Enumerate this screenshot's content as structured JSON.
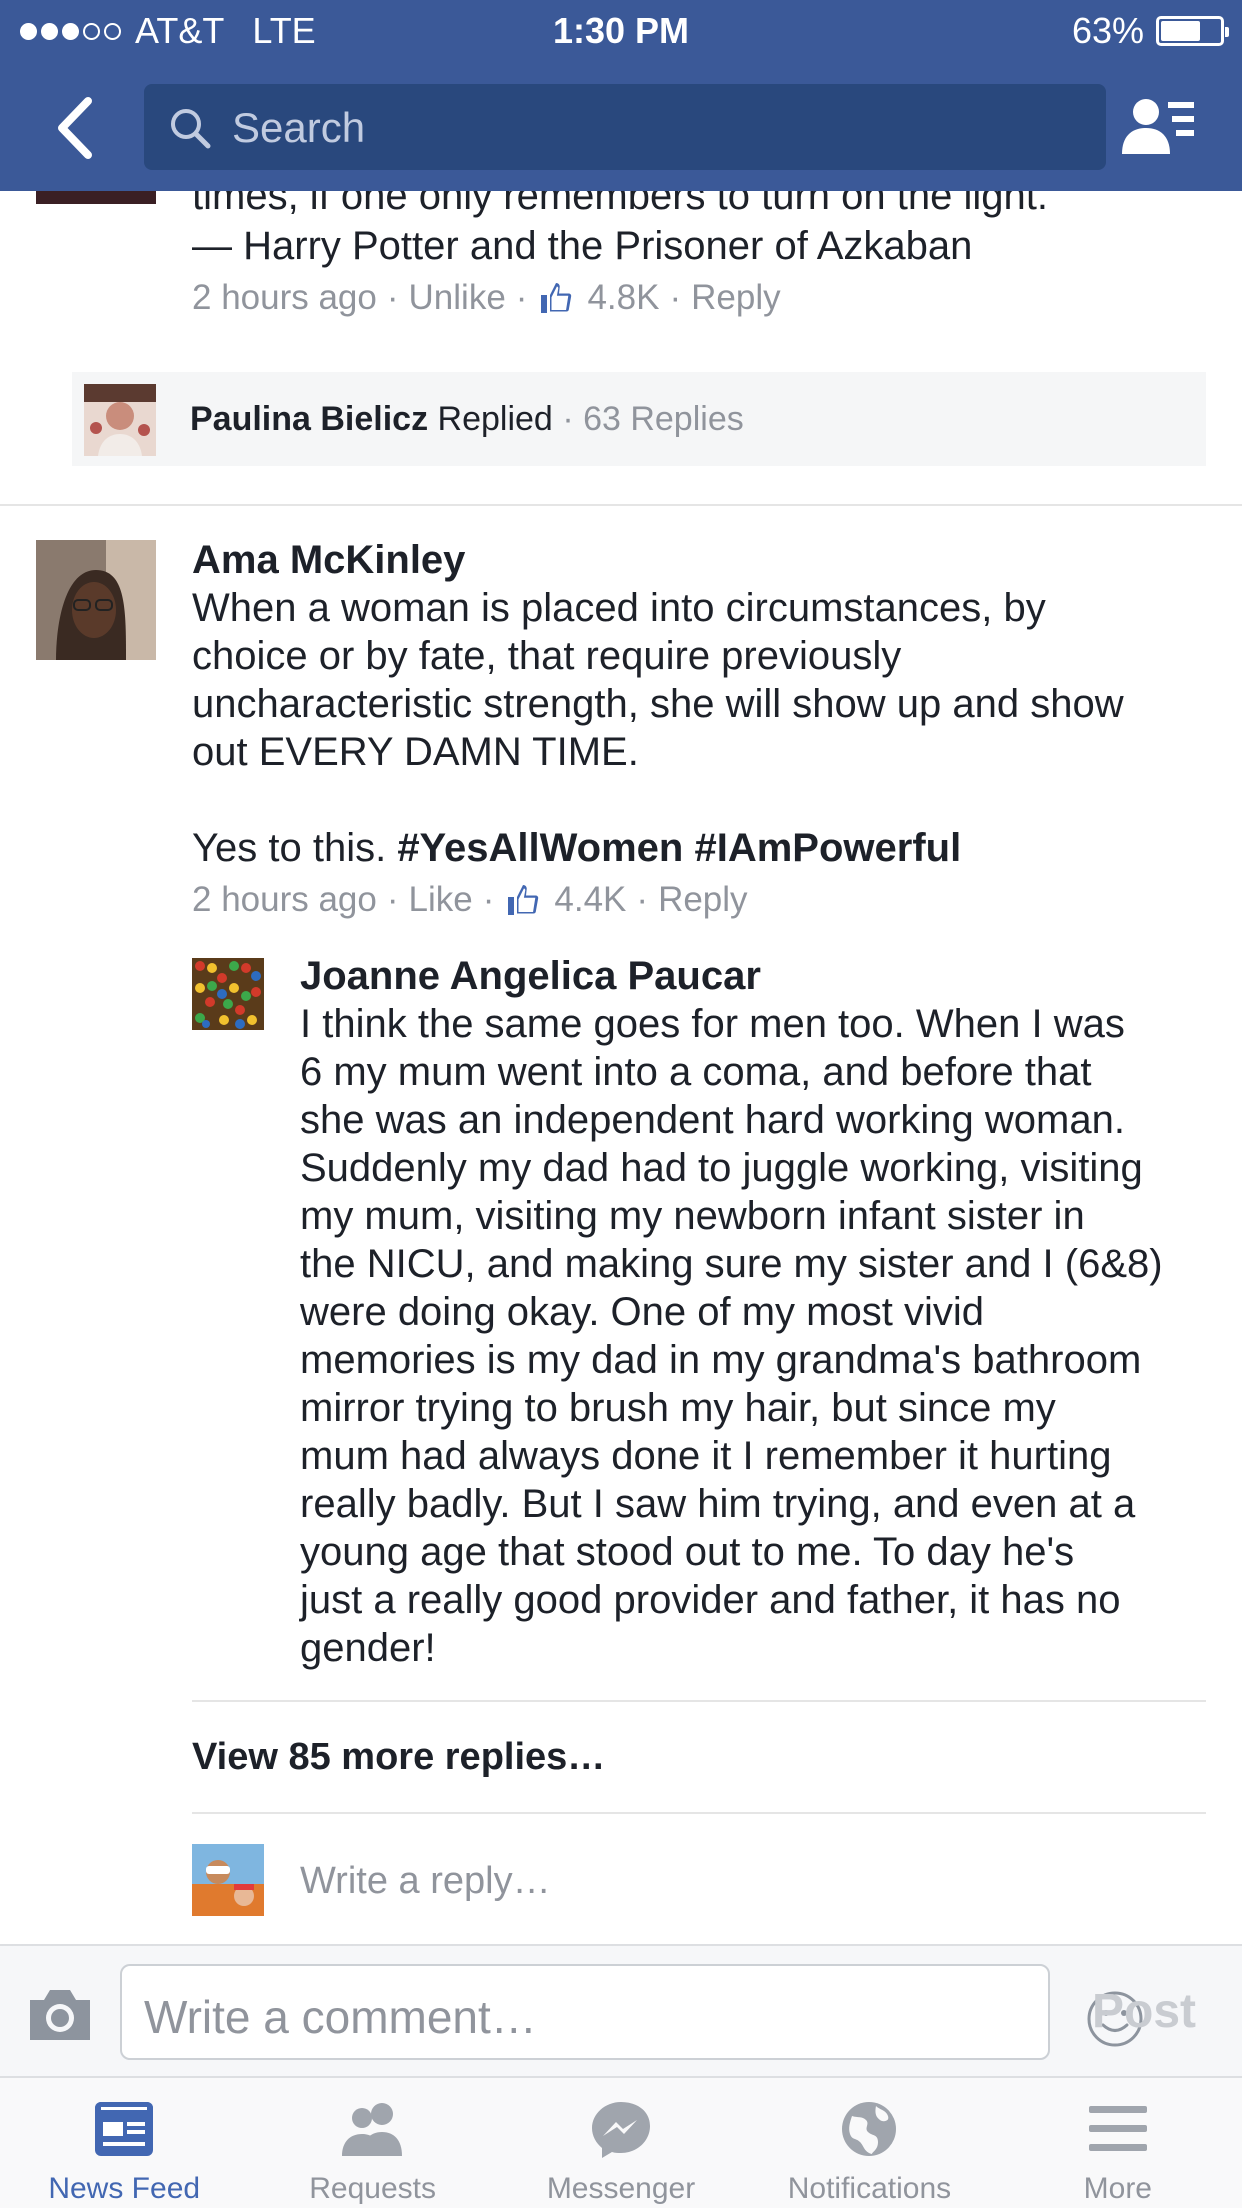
{
  "status_bar": {
    "carrier": "AT&T",
    "network": "LTE",
    "time": "1:30 PM",
    "battery": "63%",
    "battery_level": 0.63,
    "signal_bars": 3
  },
  "header": {
    "search_placeholder": "Search"
  },
  "post_tail": {
    "line1": "times, if one only remembers to turn on the light.\"",
    "line2": "— Harry Potter and the Prisoner of Azkaban",
    "time": "2 hours ago",
    "action": "Unlike",
    "likes": "4.8K",
    "reply": "Reply"
  },
  "replied_preview": {
    "name": "Paulina Bielicz",
    "verb": "Replied",
    "count": "· 63 Replies"
  },
  "comment": {
    "author": "Ama McKinley",
    "lines": [
      "When a woman is placed into circumstances, by",
      "choice or by fate, that require previously",
      "uncharacteristic strength, she will show up and show",
      "out EVERY DAMN TIME."
    ],
    "line_yes_prefix": "Yes to this. ",
    "hashtags": "#YesAllWomen #IAmPowerful",
    "time": "2 hours ago",
    "action": "Like",
    "likes": "4.4K",
    "reply": "Reply"
  },
  "reply": {
    "author": "Joanne Angelica Paucar",
    "lines": [
      "I think the same goes for men too. When I was",
      "6 my mum went into a coma, and before that",
      "she was an independent hard working woman.",
      "Suddenly my dad had to juggle working, visiting",
      "my mum, visiting my newborn infant sister in",
      "the NICU, and making sure my sister and I (6&8)",
      "were doing okay. One of my most vivid",
      "memories is my dad in my grandma's bathroom",
      "mirror trying to brush my hair, but since my",
      "mum had always done it I remember it hurting",
      "really badly. But I saw him trying, and even at a",
      "young age that stood out to me. To day he's",
      "just a really good provider and father, it has no",
      "gender!"
    ]
  },
  "view_more": "View 85 more replies…",
  "write_reply": "Write a reply…",
  "composer": {
    "placeholder": "Write a comment…",
    "post": "Post"
  },
  "tabs": [
    {
      "label": "News Feed",
      "icon": "news-feed-icon",
      "active": true
    },
    {
      "label": "Requests",
      "icon": "friend-requests-icon",
      "active": false
    },
    {
      "label": "Messenger",
      "icon": "messenger-icon",
      "active": false
    },
    {
      "label": "Notifications",
      "icon": "globe-icon",
      "active": false
    },
    {
      "label": "More",
      "icon": "menu-icon",
      "active": false
    }
  ],
  "colors": {
    "brand": "#3b5998",
    "search_bg": "#29487d",
    "active_tab": "#4267b2",
    "muted": "#90949c",
    "like_blue": "#4267b2"
  }
}
